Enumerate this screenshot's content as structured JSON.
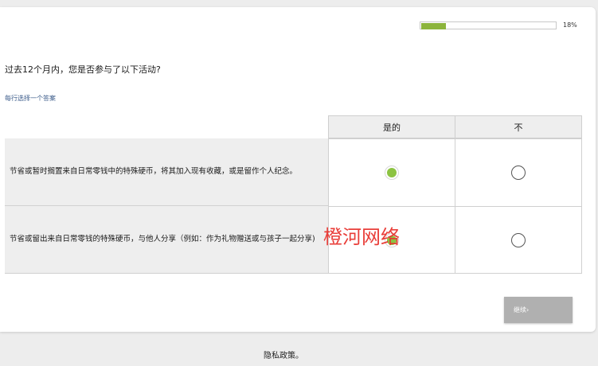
{
  "progress": {
    "percent_label": "18%",
    "fraction": 0.18
  },
  "question": {
    "text": "过去12个月内，您是否参与了以下活动?",
    "instruction": "每行选择一个答案"
  },
  "grid": {
    "columns": [
      "是的",
      "不"
    ],
    "rows": [
      {
        "label": "节省或暂时搁置来自日常零钱中的特殊硬币，将其加入现有收藏，或是留作个人纪念。",
        "selected": 0
      },
      {
        "label": "节省或留出来自日常零钱的特殊硬币，与他人分享（例如：作为礼物赠送或与孩子一起分享)",
        "selected": 0
      }
    ]
  },
  "watermark": "橙河网络",
  "continue_button": "继续›",
  "footer": {
    "privacy_link": "隐私政策。"
  },
  "colors": {
    "accent": "#8cc342",
    "progress_fill": "#8cb43c",
    "button": "#b0b0b0"
  }
}
